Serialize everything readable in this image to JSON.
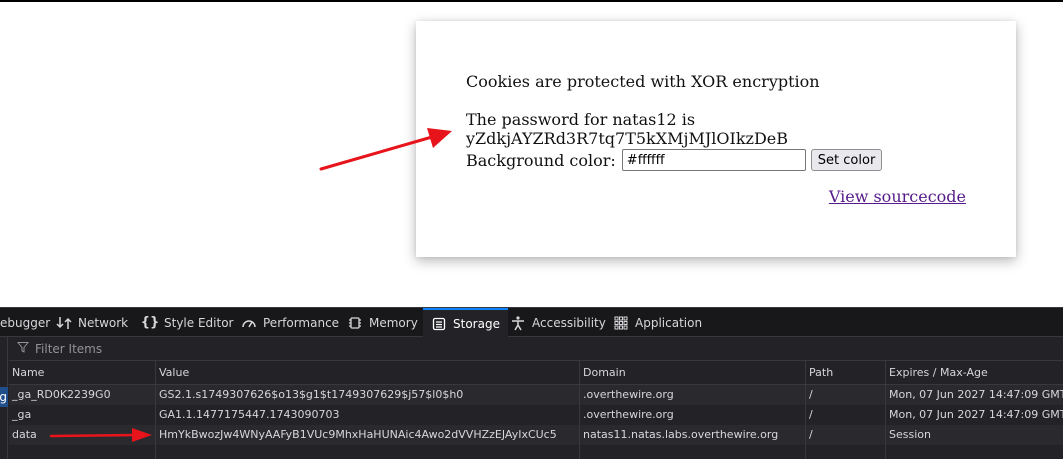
{
  "page": {
    "heading": "Cookies are protected with XOR encryption",
    "password_line1": "The password for natas12 is",
    "password_line2": "yZdkjAYZRd3R7tq7T5kXMjMJlOIkzDeB",
    "bg_label": "Background color:",
    "bg_value": "#ffffff",
    "set_color_label": "Set color",
    "source_link": "View sourcecode"
  },
  "devtools": {
    "tabs": [
      {
        "label": "ebugger",
        "icon": "debugger-icon"
      },
      {
        "label": "Network",
        "icon": "network-icon"
      },
      {
        "label": "Style Editor",
        "icon": "style-editor-icon"
      },
      {
        "label": "Performance",
        "icon": "performance-icon"
      },
      {
        "label": "Memory",
        "icon": "memory-icon"
      },
      {
        "label": "Storage",
        "icon": "storage-icon",
        "active": true
      },
      {
        "label": "Accessibility",
        "icon": "accessibility-icon"
      },
      {
        "label": "Application",
        "icon": "application-icon"
      }
    ],
    "sidebar_selected": "rg",
    "filter_placeholder": "Filter Items",
    "columns": [
      "Name",
      "Value",
      "Domain",
      "Path",
      "Expires / Max-Age"
    ],
    "rows": [
      [
        "_ga_RD0K2239G0",
        "GS2.1.s1749307626$o13$g1$t1749307629$j57$l0$h0",
        ".overthewire.org",
        "/",
        "Mon, 07 Jun 2027 14:47:09 GMT"
      ],
      [
        "_ga",
        "GA1.1.1477175447.1743090703",
        ".overthewire.org",
        "/",
        "Mon, 07 Jun 2027 14:47:09 GMT"
      ],
      [
        "data",
        "HmYkBwozJw4WNyAAFyB1VUc9MhxHaHUNAic4Awo2dVVHZzEJAyIxCUc5",
        "natas11.natas.labs.overthewire.org",
        "/",
        "Session"
      ]
    ]
  },
  "colors": {
    "annotation_arrow": "#e8141b",
    "devtools_bg": "#232327",
    "active_tab_accent": "#0a84ff",
    "link_visited": "#551a8b"
  }
}
